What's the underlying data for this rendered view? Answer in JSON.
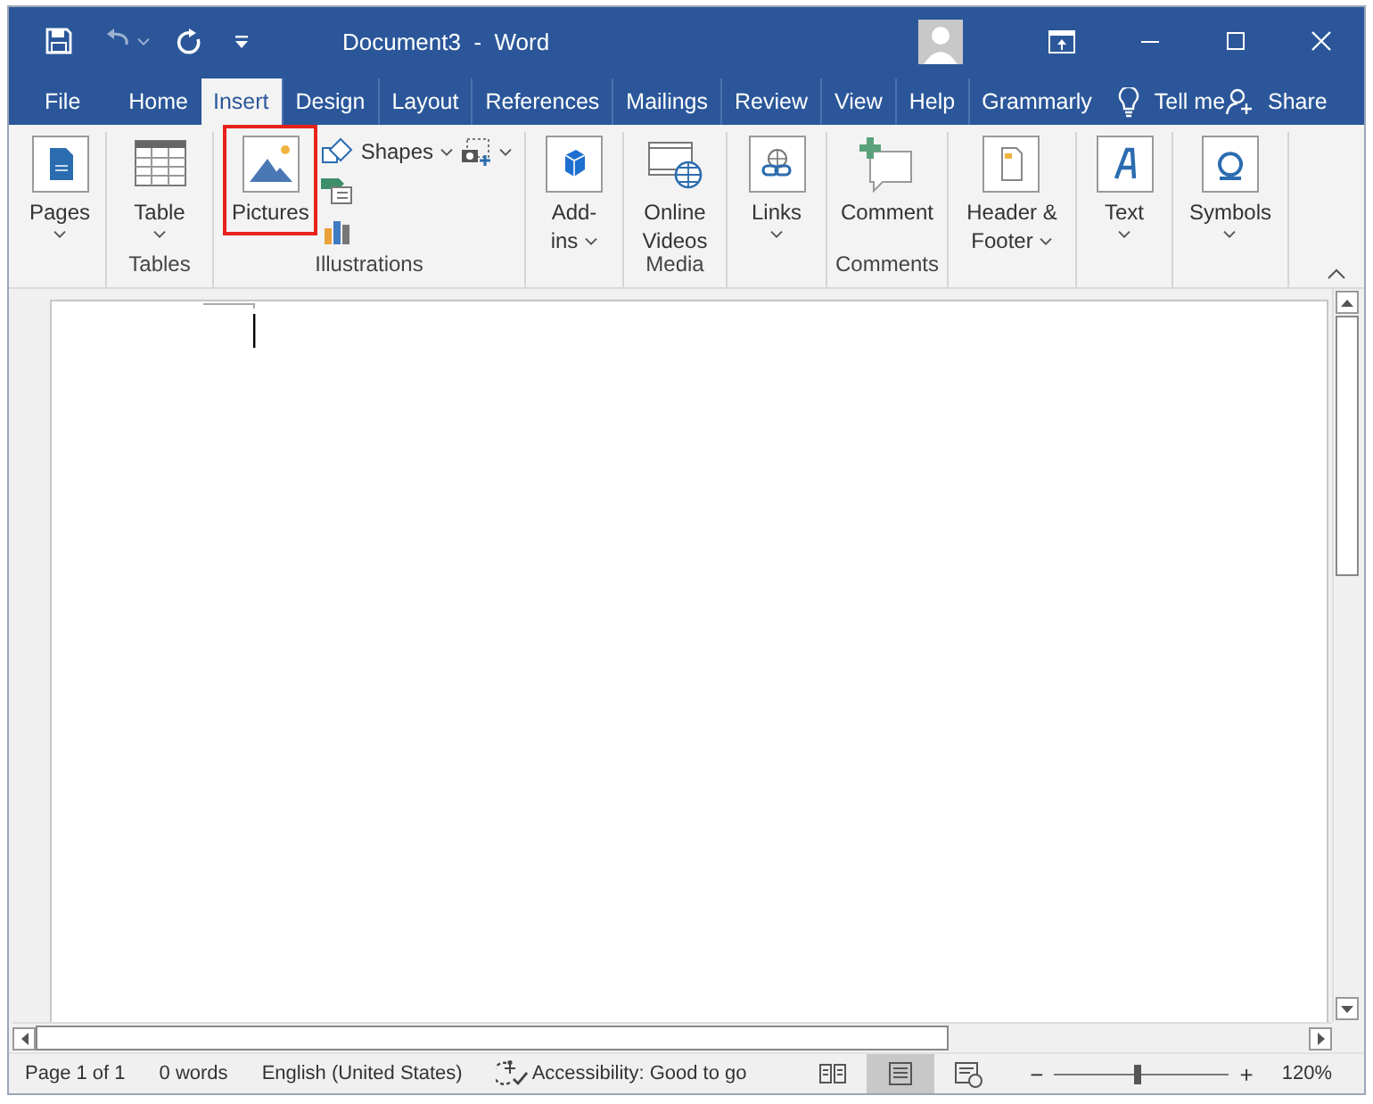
{
  "window": {
    "title": "Document3  -  Word"
  },
  "tabs": [
    {
      "label": "File",
      "selected": false
    },
    {
      "label": "Home",
      "selected": false
    },
    {
      "label": "Insert",
      "selected": true
    },
    {
      "label": "Design",
      "selected": false
    },
    {
      "label": "Layout",
      "selected": false
    },
    {
      "label": "References",
      "selected": false
    },
    {
      "label": "Mailings",
      "selected": false
    },
    {
      "label": "Review",
      "selected": false
    },
    {
      "label": "View",
      "selected": false
    },
    {
      "label": "Help",
      "selected": false
    },
    {
      "label": "Grammarly",
      "selected": false
    }
  ],
  "tell_me": "Tell me",
  "share": "Share",
  "ribbon": {
    "groups": [
      {
        "commands": [
          {
            "lines": [
              "Pages"
            ],
            "dropdown": true,
            "highlighted": false
          }
        ]
      },
      {
        "label": "Tables",
        "commands": [
          {
            "lines": [
              "Table"
            ],
            "dropdown": true,
            "highlighted": false
          }
        ]
      },
      {
        "label": "Illustrations",
        "commands": [
          {
            "lines": [
              "Pictures"
            ],
            "dropdown": false,
            "highlighted": true
          }
        ],
        "small_commands": [
          {
            "label": "Shapes",
            "dropdown": true
          },
          {
            "dropdown": false
          },
          {
            "dropdown": false
          },
          {
            "dropdown": true
          }
        ]
      },
      {
        "commands": [
          {
            "lines": [
              "Add-",
              "ins"
            ],
            "dropdown": true,
            "highlighted": false
          }
        ]
      },
      {
        "label": "Media",
        "commands": [
          {
            "lines": [
              "Online",
              "Videos"
            ],
            "dropdown": false,
            "highlighted": false
          }
        ]
      },
      {
        "commands": [
          {
            "lines": [
              "Links"
            ],
            "dropdown": true,
            "highlighted": false
          }
        ]
      },
      {
        "label": "Comments",
        "commands": [
          {
            "lines": [
              "Comment"
            ],
            "dropdown": false,
            "highlighted": false
          }
        ]
      },
      {
        "commands": [
          {
            "lines": [
              "Header &",
              "Footer"
            ],
            "dropdown": true,
            "highlighted": false
          }
        ]
      },
      {
        "commands": [
          {
            "lines": [
              "Text"
            ],
            "dropdown": true,
            "highlighted": false
          }
        ]
      },
      {
        "commands": [
          {
            "lines": [
              "Symbols"
            ],
            "dropdown": true,
            "highlighted": false
          }
        ]
      }
    ]
  },
  "status_bar": {
    "items": [
      "Page 1 of 1",
      "0 words",
      "English (United States)"
    ],
    "accessibility": "Accessibility: Good to go",
    "views": [
      {
        "selected": false
      },
      {
        "selected": true
      },
      {
        "selected": false
      }
    ],
    "zoom_out": "−",
    "zoom_in": "+",
    "zoom": {
      "level": 0.46
    },
    "zoom_percent": "120%"
  }
}
